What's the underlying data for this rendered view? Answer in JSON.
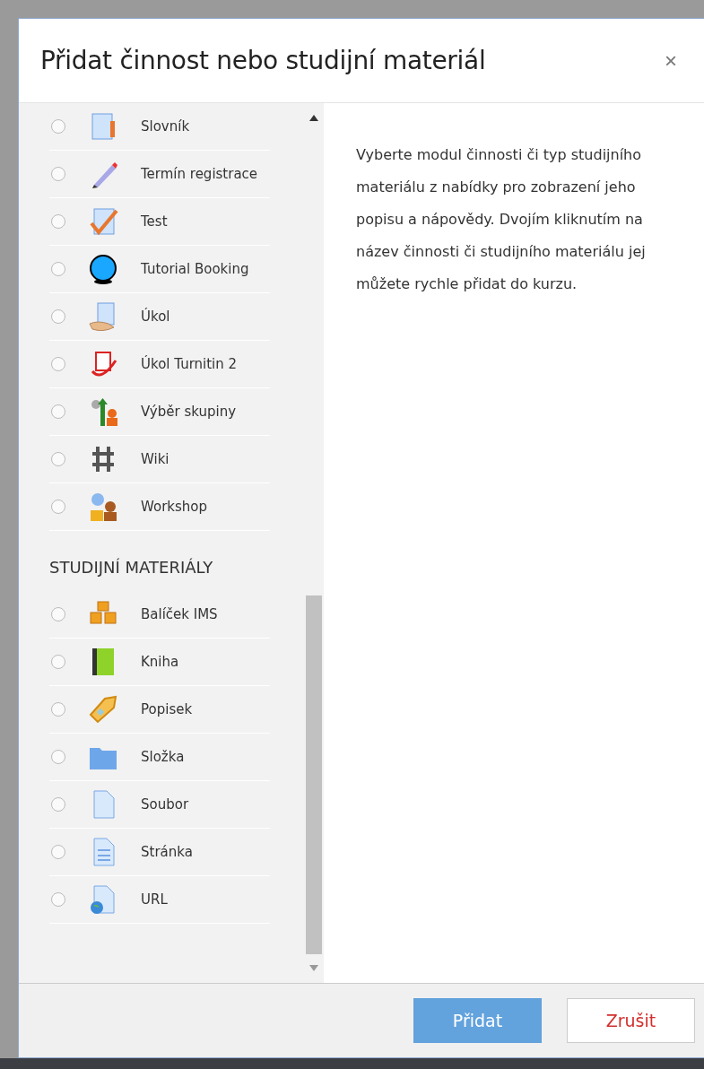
{
  "dialog": {
    "title": "Přidat činnost nebo studijní materiál",
    "close": "×"
  },
  "sections": [
    {
      "items": [
        {
          "label": "Slovník",
          "selected": false
        },
        {
          "label": "Termín registrace",
          "selected": false
        },
        {
          "label": "Test",
          "selected": false
        },
        {
          "label": "Tutorial Booking",
          "selected": false
        },
        {
          "label": "Úkol",
          "selected": false
        },
        {
          "label": "Úkol Turnitin 2",
          "selected": false
        },
        {
          "label": "Výběr skupiny",
          "selected": false
        },
        {
          "label": "Wiki",
          "selected": false
        },
        {
          "label": "Workshop",
          "selected": false
        }
      ]
    },
    {
      "heading": "STUDIJNÍ MATERIÁLY",
      "items": [
        {
          "label": "Balíček IMS",
          "selected": false
        },
        {
          "label": "Kniha",
          "selected": false
        },
        {
          "label": "Popisek",
          "selected": false
        },
        {
          "label": "Složka",
          "selected": false
        },
        {
          "label": "Soubor",
          "selected": false
        },
        {
          "label": "Stránka",
          "selected": false
        },
        {
          "label": "URL",
          "selected": false
        }
      ]
    }
  ],
  "help": "Vyberte modul činnosti či typ studijního materiálu z nabídky pro zobrazení jeho popisu a nápovědy. Dvojím kliknutím na název činnosti či studijního materiálu jej můžete rychle přidat do kurzu.",
  "buttons": [
    {
      "label": "Přidat",
      "kind": "primary"
    },
    {
      "label": "Zrušit",
      "kind": "cancel"
    }
  ]
}
